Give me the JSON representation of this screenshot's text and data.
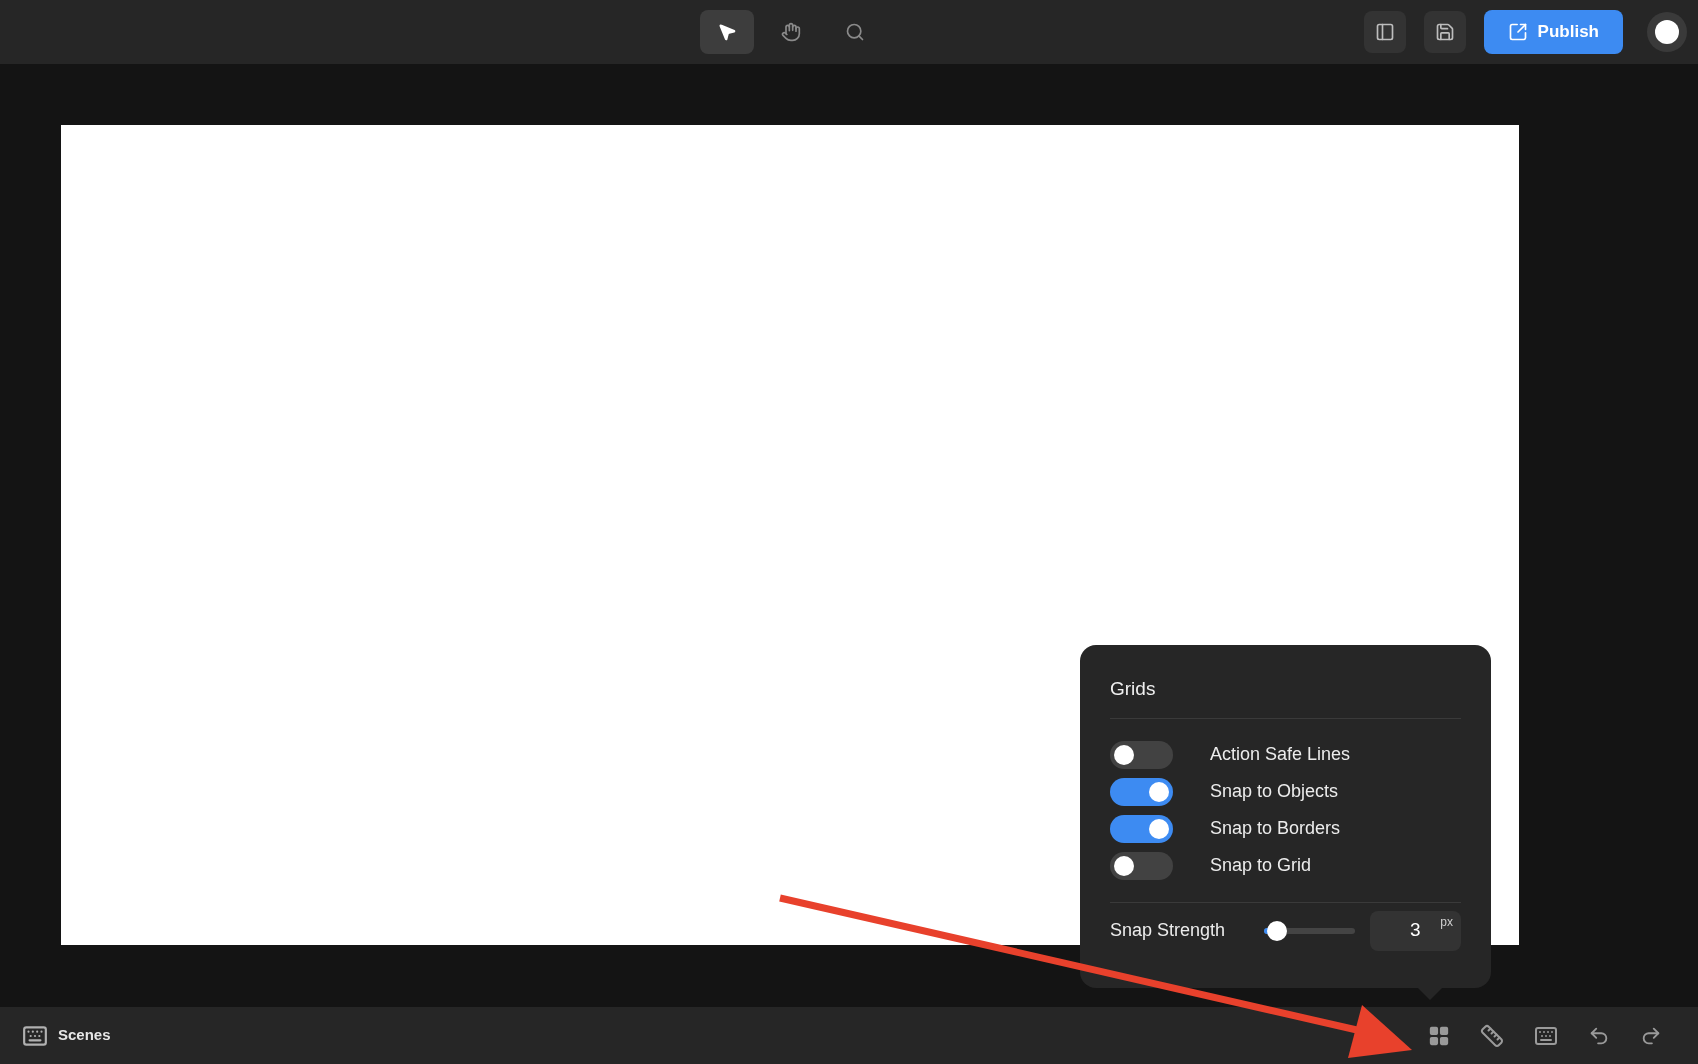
{
  "toolbar": {
    "tools": [
      {
        "kind": "select",
        "selected": true
      },
      {
        "kind": "hand",
        "selected": false
      },
      {
        "kind": "zoom",
        "selected": false
      }
    ],
    "publish_button": "Publish"
  },
  "grids_popover": {
    "title": "Grids",
    "toggles": [
      {
        "label": "Action Safe Lines",
        "on": false
      },
      {
        "label": "Snap to Objects",
        "on": true
      },
      {
        "label": "Snap to Borders",
        "on": true
      },
      {
        "label": "Snap to Grid",
        "on": false
      }
    ],
    "snap_strength": {
      "label": "Snap Strength",
      "level": 0.15,
      "value": "3",
      "unit": "px"
    }
  },
  "bottom_bar": {
    "scenes_label": "Scenes"
  }
}
